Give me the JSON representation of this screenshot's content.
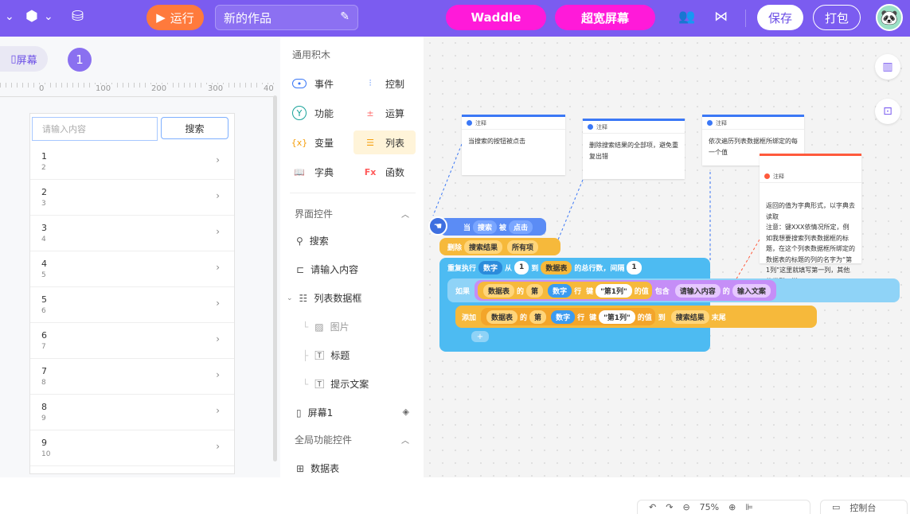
{
  "topbar": {
    "run_label": "运行",
    "project_title": "新的作品",
    "waddle_label": "Waddle",
    "widescreen_label": "超宽屏幕",
    "save_label": "保存",
    "pack_label": "打包"
  },
  "left": {
    "screen_tab": "屏幕",
    "screen_number": "1",
    "ruler": [
      "0",
      "100",
      "200",
      "300",
      "40"
    ],
    "search_placeholder": "请输入内容",
    "search_button": "搜索",
    "rows": [
      {
        "title": "1",
        "sub": "2"
      },
      {
        "title": "2",
        "sub": "3"
      },
      {
        "title": "3",
        "sub": "4"
      },
      {
        "title": "4",
        "sub": "5"
      },
      {
        "title": "5",
        "sub": "6"
      },
      {
        "title": "6",
        "sub": "7"
      },
      {
        "title": "7",
        "sub": "8"
      },
      {
        "title": "8",
        "sub": "9"
      },
      {
        "title": "9",
        "sub": "10"
      }
    ]
  },
  "palette": {
    "common_title": "通用积木",
    "blocks": [
      {
        "label": "事件",
        "icon": "event-icon"
      },
      {
        "label": "控制",
        "icon": "control-icon"
      },
      {
        "label": "功能",
        "icon": "function-icon"
      },
      {
        "label": "运算",
        "icon": "operator-icon"
      },
      {
        "label": "变量",
        "icon": "variable-icon"
      },
      {
        "label": "列表",
        "icon": "list-icon"
      },
      {
        "label": "字典",
        "icon": "dictionary-icon"
      },
      {
        "label": "函数",
        "icon": "fx-icon"
      }
    ],
    "ui_title": "界面控件",
    "ui_items": [
      "搜索",
      "请输入内容",
      "列表数据框",
      "图片",
      "标题",
      "提示文案",
      "屏幕1"
    ],
    "global_title": "全局功能控件",
    "global_items": [
      "数据表"
    ]
  },
  "notes": [
    {
      "head": "注释",
      "body": "当搜索的按钮被点击"
    },
    {
      "head": "注释",
      "body": "删除搜索结果的全部项，避免重复出错"
    },
    {
      "head": "注释",
      "body": "依次遍历列表数据框所绑定的每一个值"
    },
    {
      "head": "注释",
      "body": "返回的值为字典形式，以字典去读取\n注意：键XXX依情况所定，例如我想要搜索列表数据框的标题，在这个列表数据框所绑定的数据表的标题的列的名字为“第1列”这里就填写第一列，其他的类型一样"
    }
  ],
  "blocks": {
    "when": "当",
    "search": "搜索",
    "by": "被",
    "click": "点击",
    "delete": "删除",
    "search_result": "搜索结果",
    "all_items": "所有项",
    "repeat": "重复执行",
    "number": "数字",
    "from": "从",
    "one": "1",
    "to": "到",
    "datatable": "数据表",
    "total_rows": "的总行数",
    "interval": "，间隔",
    "if": "如果",
    "of": "的",
    "nth": "第",
    "row": "行",
    "key": "键",
    "col1": "\"第1列\"",
    "value": "的值",
    "contains": "包含",
    "input_content": "请输入内容",
    "input_text": "输入文案",
    "add": "添加",
    "to2": "到",
    "end": "末尾"
  },
  "bottom": {
    "zoom": "75%",
    "console": "控制台"
  },
  "colors": {
    "accent": "#7b5cf0",
    "run": "#ff7a3c",
    "pink": "#ff1ad9",
    "event_block": "#5b8cf5",
    "list_block": "#f6b93b",
    "control_block": "#4dbbf2"
  }
}
